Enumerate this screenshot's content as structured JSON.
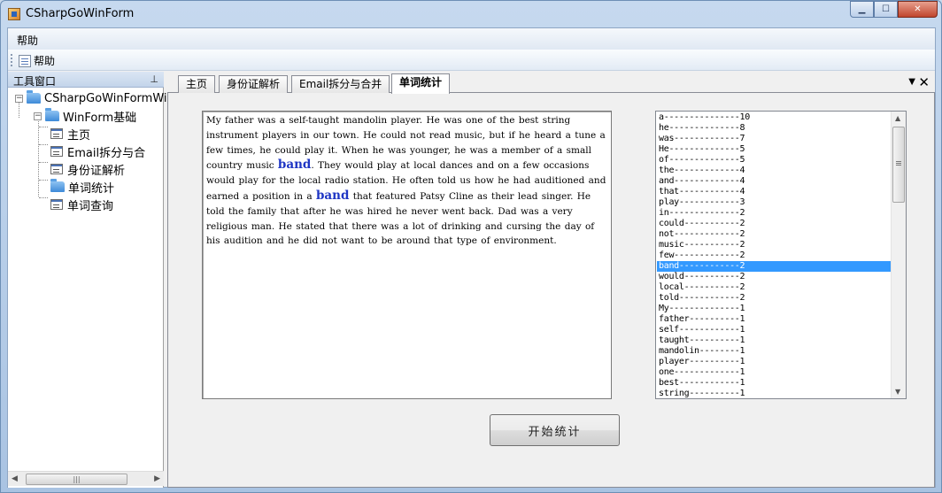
{
  "window": {
    "title": "CSharpGoWinForm"
  },
  "menu": {
    "help": "帮助"
  },
  "toolbar": {
    "help": "帮助"
  },
  "toolpanel": {
    "title": "工具窗口",
    "tree": {
      "root": "CSharpGoWinFormWin",
      "group": "WinForm基础",
      "items": [
        "主页",
        "Email拆分与合",
        "身份证解析",
        "单词统计",
        "单词查询"
      ]
    }
  },
  "tabs": [
    "主页",
    "身份证解析",
    "Email拆分与合并",
    "单词统计"
  ],
  "active_tab": "单词统计",
  "text": {
    "before1": "My father was a self-taught mandolin player. He was one of the best string instrument players in our town. He could not read music, but if he heard a tune a few times, he could play it. When he was younger, he was a member of a small country music ",
    "band1": "band",
    "middle": ". They would play at local dances and on a few occasions would play for the local radio station. He often told us how he had auditioned and earned a position in a ",
    "band2": "band",
    "after": " that featured Patsy Cline as their lead singer. He told the family that after he was hired he never went back. Dad was a very religious man. He stated that there was a lot of drinking and cursing the day of his audition and he did not want to be around that type of environment."
  },
  "word_counts": [
    "a---------------10",
    "he--------------8",
    "was-------------7",
    "He--------------5",
    "of--------------5",
    "the-------------4",
    "and-------------4",
    "that------------4",
    "play------------3",
    "in--------------2",
    "could-----------2",
    "not-------------2",
    "music-----------2",
    "few-------------2",
    "band------------2",
    "would-----------2",
    "local-----------2",
    "told------------2",
    "My--------------1",
    "father----------1",
    "self------------1",
    "taught----------1",
    "mandolin--------1",
    "player----------1",
    "one-------------1",
    "best------------1",
    "string----------1"
  ],
  "selected_word": "band------------2",
  "start_button": "开始统计"
}
